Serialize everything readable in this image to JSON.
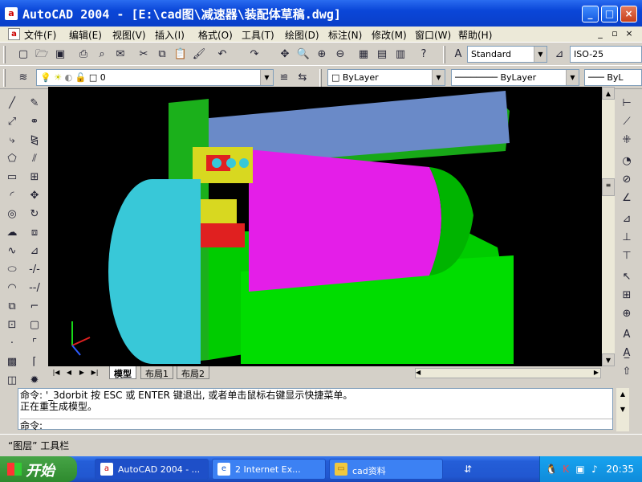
{
  "window": {
    "title": "AutoCAD 2004 - [E:\\cad图\\减速器\\装配体草稿.dwg]",
    "app_icon": "autocad-icon",
    "minimize": "_",
    "maximize": "□",
    "close": "×"
  },
  "menu": {
    "items": [
      "文件(F)",
      "编辑(E)",
      "视图(V)",
      "插入(I)",
      "格式(O)",
      "工具(T)",
      "绘图(D)",
      "标注(N)",
      "修改(M)",
      "窗口(W)",
      "帮助(H)"
    ],
    "doc_minimize": "_",
    "doc_restore": "▫",
    "doc_close": "×"
  },
  "toolbar_standard": {
    "text_style": "Standard",
    "dim_style": "ISO-25"
  },
  "toolbar_layers": {
    "current_layer": "0",
    "color": "ByLayer",
    "linetype": "ByLayer",
    "lineweight": "ByL"
  },
  "layout_tabs": {
    "tabs": [
      "模型",
      "布局1",
      "布局2"
    ],
    "active": "模型"
  },
  "command": {
    "lines": [
      "命令: '_3dorbit 按 ESC 或 ENTER 键退出, 或者单击鼠标右键显示快捷菜单。",
      "正在重生成模型。"
    ],
    "prompt": "命令:"
  },
  "status": {
    "text": "“图层” 工具栏"
  },
  "taskbar": {
    "start_label": "开始",
    "tasks": [
      {
        "label": "AutoCAD 2004 - ...",
        "icon": "autocad-icon"
      },
      {
        "label": "2 Internet Ex...",
        "icon": "ie-icon"
      },
      {
        "label": "cad资料",
        "icon": "folder-icon"
      }
    ],
    "clock": "20:35"
  },
  "colors": {
    "viewport_bg": "#000000",
    "model_cyan": "#33c8d8",
    "model_green": "#00dd00",
    "model_magenta": "#e020e8",
    "model_red": "#e02020",
    "model_yellow": "#d8d820",
    "titlebar": "#0a46d8",
    "taskbar": "#245ed8"
  }
}
